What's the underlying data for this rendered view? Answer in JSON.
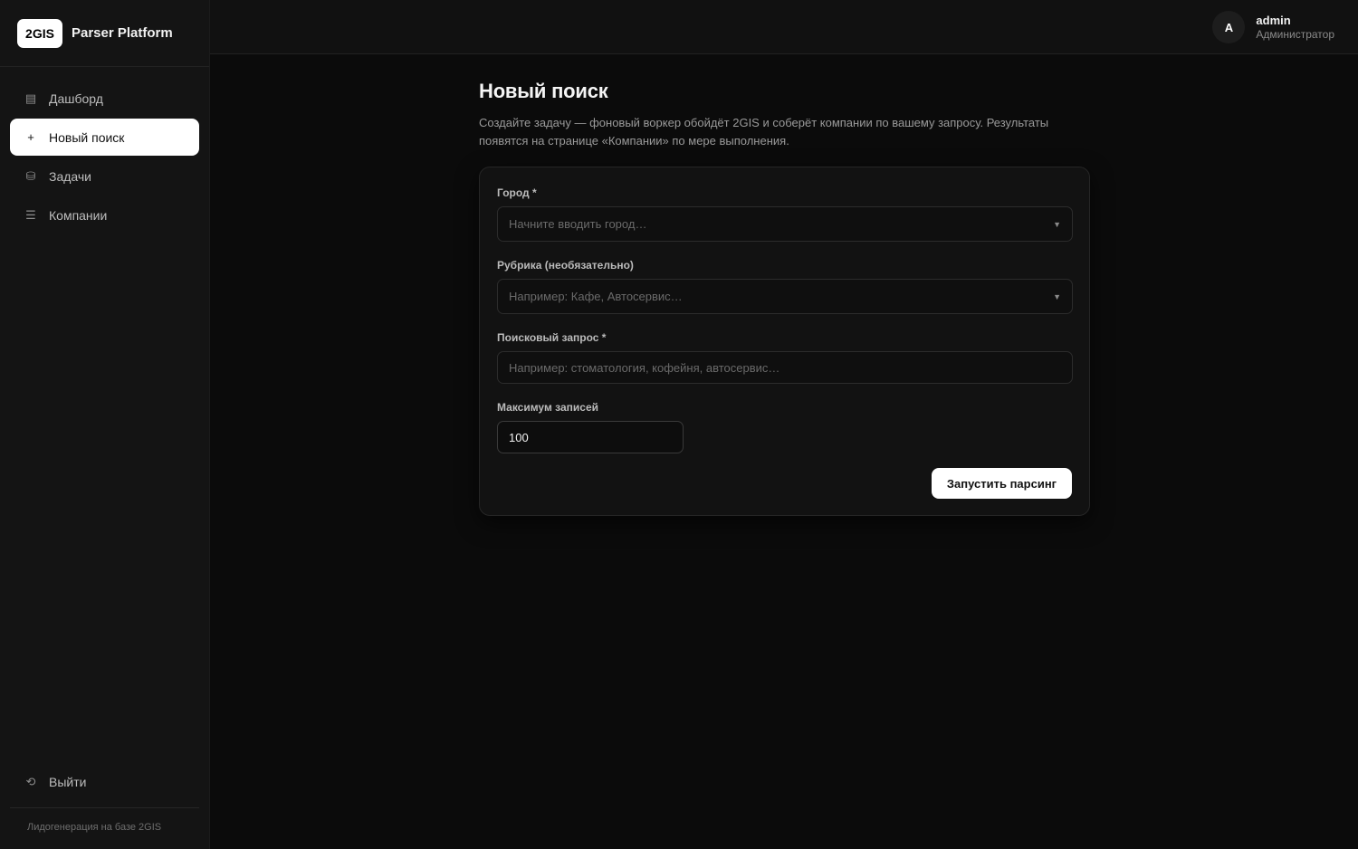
{
  "brand": {
    "logo": "2GIS",
    "name": "Parser Platform"
  },
  "sidebar": {
    "items": [
      {
        "label": "Дашборд",
        "icon": "grid-icon",
        "glyph": "▤"
      },
      {
        "label": "Новый поиск",
        "icon": "plus-icon",
        "glyph": "+"
      },
      {
        "label": "Задачи",
        "icon": "database-icon",
        "glyph": "⛁"
      },
      {
        "label": "Компании",
        "icon": "list-icon",
        "glyph": "☰"
      }
    ],
    "active_index": 1,
    "logout": {
      "label": "Выйти",
      "icon": "logout-icon",
      "glyph": "⟲"
    },
    "footer": "Лидогенерация на базе 2GIS"
  },
  "user": {
    "initial": "A",
    "name": "admin",
    "role": "Администратор"
  },
  "page": {
    "title": "Новый поиск",
    "description": "Создайте задачу — фоновый воркер обойдёт 2GIS и соберёт компании по вашему запросу. Результаты появятся на странице «Компании» по мере выполнения."
  },
  "form": {
    "city": {
      "label": "Город *",
      "placeholder": "Начните вводить город…"
    },
    "rubric": {
      "label": "Рубрика (необязательно)",
      "placeholder": "Например: Кафе, Автосервис…"
    },
    "query": {
      "label": "Поисковый запрос *",
      "placeholder": "Например: стоматология, кофейня, автосервис…"
    },
    "max": {
      "label": "Максимум записей",
      "value": "100"
    },
    "submit_label": "Запустить парсинг"
  },
  "colors": {
    "background": "#0b0b0b",
    "sidebar": "#141414",
    "accent": "#ffffff"
  }
}
